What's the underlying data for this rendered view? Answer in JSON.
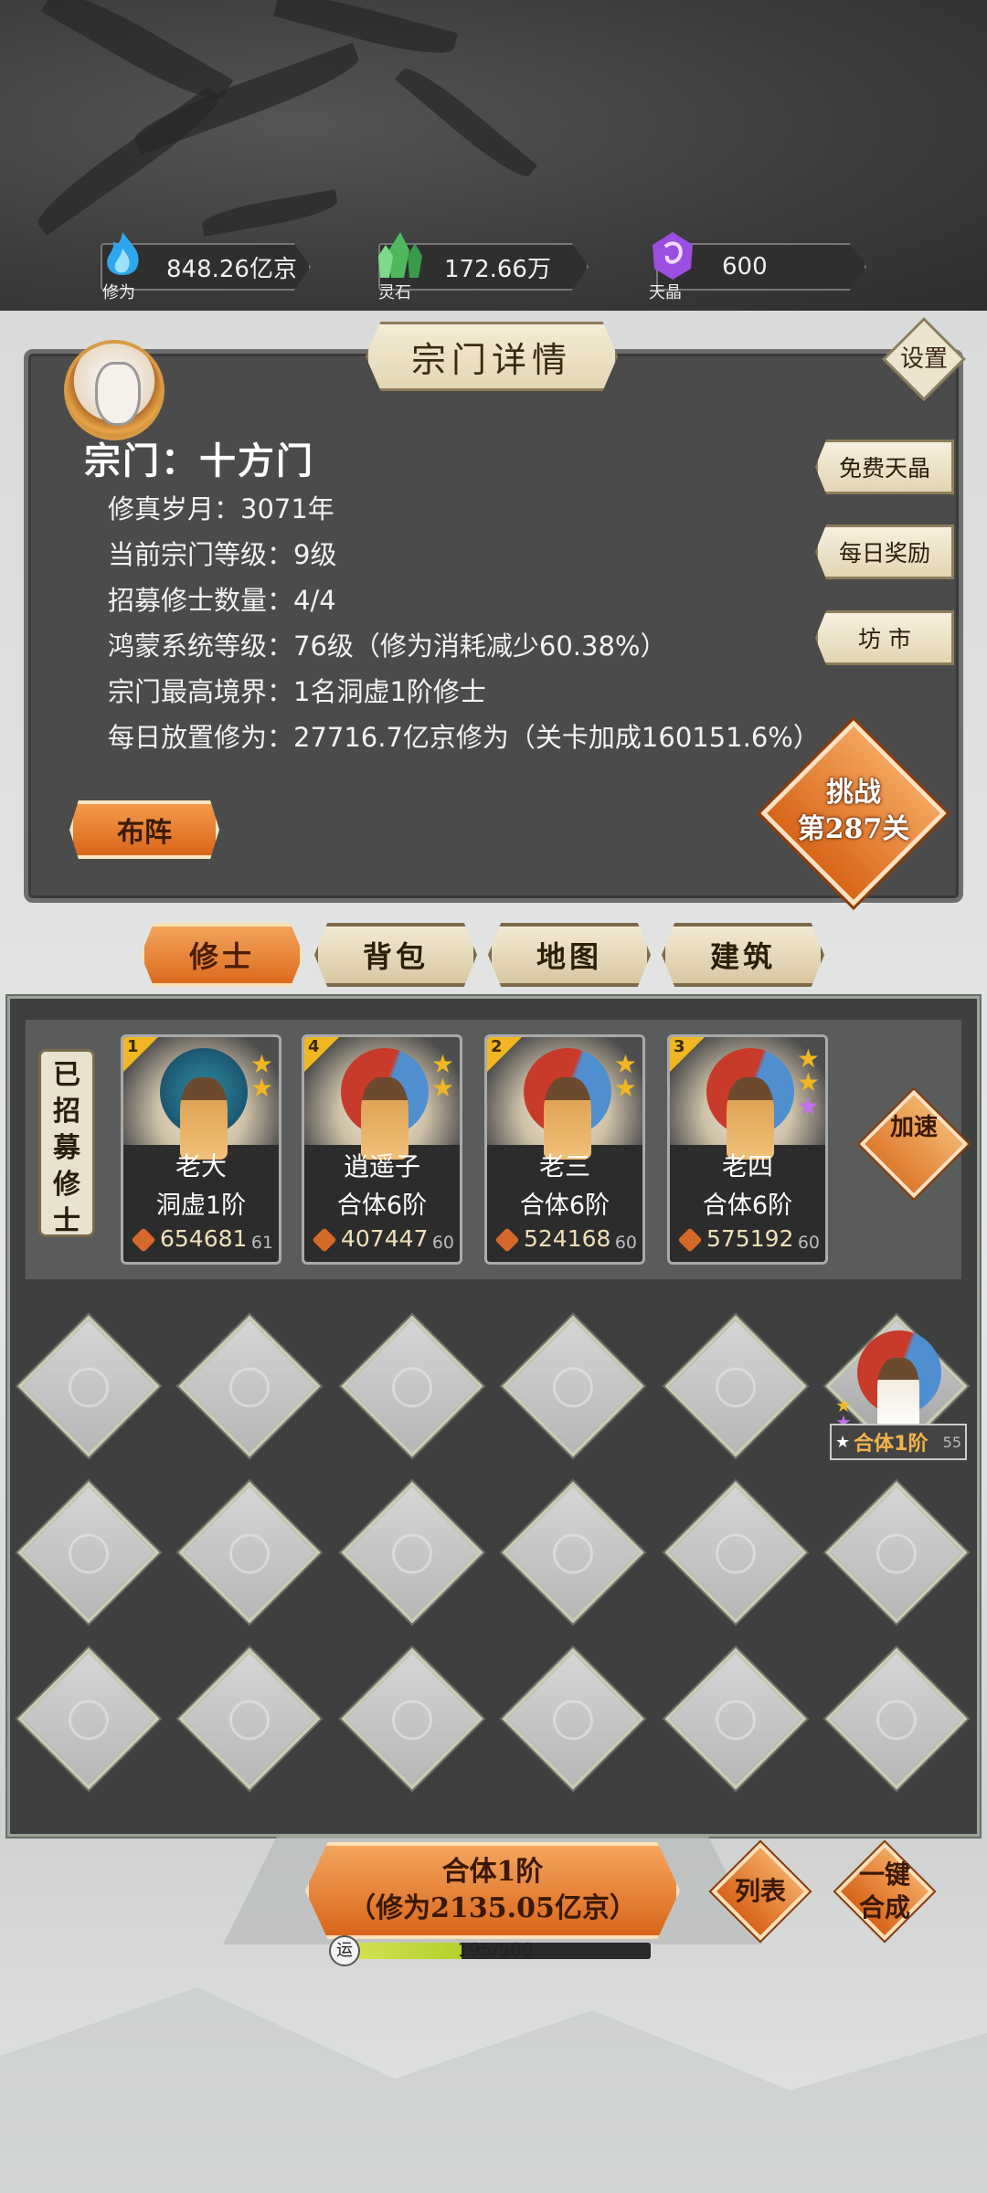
{
  "resources": [
    {
      "label": "修为",
      "value": "848.26亿京",
      "icon": "spirit-flame-icon",
      "color": "#3fb8f2"
    },
    {
      "label": "灵石",
      "value": "172.66万",
      "icon": "spirit-stone-icon",
      "color": "#5cc46a"
    },
    {
      "label": "天晶",
      "value": "600",
      "icon": "sky-crystal-icon",
      "color": "#a35ae0"
    }
  ],
  "panel": {
    "title": "宗门详情",
    "settings": "设置",
    "sect_name": "宗门：十方门",
    "info": [
      "修真岁月：3071年",
      "当前宗门等级：9级",
      "招募修士数量：4/4",
      "鸿蒙系统等级：76级（修为消耗减少60.38%）",
      "宗门最高境界：1名洞虚1阶修士",
      "每日放置修为：27716.7亿京修为（关卡加成160151.6%）"
    ],
    "side_buttons": [
      "免费天晶",
      "每日奖励",
      "坊 市"
    ],
    "formation": "布阵",
    "challenge_line1": "挑战",
    "challenge_line2": "第287关"
  },
  "tabs": [
    {
      "label": "修士",
      "active": true
    },
    {
      "label": "背包",
      "active": false
    },
    {
      "label": "地图",
      "active": false
    },
    {
      "label": "建筑",
      "active": false
    }
  ],
  "roster": {
    "recruited_label": "已招募修士",
    "speed_up": "加速",
    "cards": [
      {
        "slot": "1",
        "name": "老大",
        "realm": "洞虚1阶",
        "power": "654681",
        "level": "61",
        "stars": [
          "#f0b722",
          "#f0b722"
        ]
      },
      {
        "slot": "4",
        "name": "逍遥子",
        "realm": "合体6阶",
        "power": "407447",
        "level": "60",
        "stars": [
          "#f0b722",
          "#f0b722"
        ]
      },
      {
        "slot": "2",
        "name": "老三",
        "realm": "合体6阶",
        "power": "524168",
        "level": "60",
        "stars": [
          "#f0b722",
          "#f0b722"
        ]
      },
      {
        "slot": "3",
        "name": "老四",
        "realm": "合体6阶",
        "power": "575192",
        "level": "60",
        "stars": [
          "#f0b722",
          "#f0b722",
          "#c070e8"
        ]
      }
    ],
    "waiting": {
      "realm": "合体1阶",
      "level": "55"
    }
  },
  "bottom": {
    "merge_line1": "合体1阶",
    "merge_line2": "（修为2135.05亿京）",
    "list": "列表",
    "one_click": "一键合成",
    "luck_icon": "运",
    "luck_text": "195/500",
    "luck_fraction": 0.39
  }
}
